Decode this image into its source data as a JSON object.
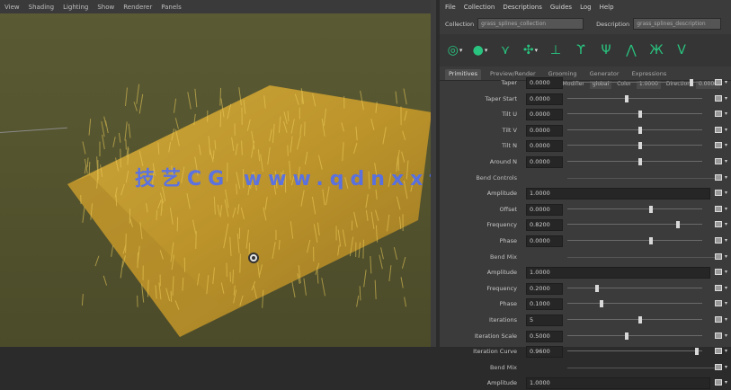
{
  "viewport": {
    "menu": [
      "View",
      "Shading",
      "Lighting",
      "Show",
      "Renderer",
      "Panels"
    ],
    "watermark": "技艺CG  www.qdnxxfb.cn"
  },
  "panel": {
    "menu": [
      "File",
      "Collection",
      "Descriptions",
      "Guides",
      "Log",
      "Help"
    ],
    "collection_label": "Collection",
    "collection_value": "grass_splines_collection",
    "description_label": "Description",
    "description_value": "grass_splines_description",
    "tools": [
      "green-select-icon",
      "green-blob-icon",
      "comb-tool-icon",
      "pull-tool-icon",
      "guide-add-icon",
      "guide-curve-icon",
      "guide-flip-icon",
      "guide-split-icon",
      "guide-pair-icon",
      "guide-vee-icon"
    ],
    "tabs": [
      "Primitives",
      "Preview/Render",
      "Grooming",
      "Generator",
      "Expressions"
    ],
    "subrow": [
      "Generator Modifier",
      "global",
      "Color",
      "1.0000",
      "Direction",
      "0.0000"
    ],
    "rows": [
      {
        "name": "Taper",
        "value": "0.0000",
        "thumb": 0.92,
        "type": "slider"
      },
      {
        "name": "Taper Start",
        "value": "0.0000",
        "thumb": 0.44,
        "type": "slider"
      },
      {
        "name": "Tilt U",
        "value": "0.0000",
        "thumb": 0.54,
        "type": "slider"
      },
      {
        "name": "Tilt V",
        "value": "0.0000",
        "thumb": 0.54,
        "type": "slider"
      },
      {
        "name": "Tilt N",
        "value": "0.0000",
        "thumb": 0.54,
        "type": "slider"
      },
      {
        "name": "Around N",
        "value": "0.0000",
        "thumb": 0.54,
        "type": "slider"
      },
      {
        "name": "Bend Controls",
        "type": "section"
      },
      {
        "name": "Amplitude",
        "value": "1.0000",
        "type": "wide"
      },
      {
        "name": "Offset",
        "value": "0.0000",
        "thumb": 0.62,
        "type": "slider"
      },
      {
        "name": "Frequency",
        "value": "0.8200",
        "thumb": 0.82,
        "type": "slider"
      },
      {
        "name": "Phase",
        "value": "0.0000",
        "thumb": 0.62,
        "type": "slider"
      },
      {
        "name": "Bend Mix",
        "type": "section"
      },
      {
        "name": "Amplitude",
        "value": "1.0000",
        "type": "wide"
      },
      {
        "name": "Frequency",
        "value": "0.2000",
        "thumb": 0.22,
        "type": "slider"
      },
      {
        "name": "Phase",
        "value": "0.1000",
        "thumb": 0.25,
        "type": "slider"
      },
      {
        "name": "Iterations",
        "value": "5",
        "thumb": 0.54,
        "type": "slider"
      },
      {
        "name": "Iteration Scale",
        "value": "0.5000",
        "thumb": 0.44,
        "type": "slider"
      },
      {
        "name": "Iteration Curve",
        "value": "0.9600",
        "thumb": 0.96,
        "type": "slider"
      },
      {
        "name": "Bend Mix",
        "type": "section"
      },
      {
        "name": "Amplitude",
        "value": "1.0000",
        "type": "wide"
      }
    ]
  }
}
